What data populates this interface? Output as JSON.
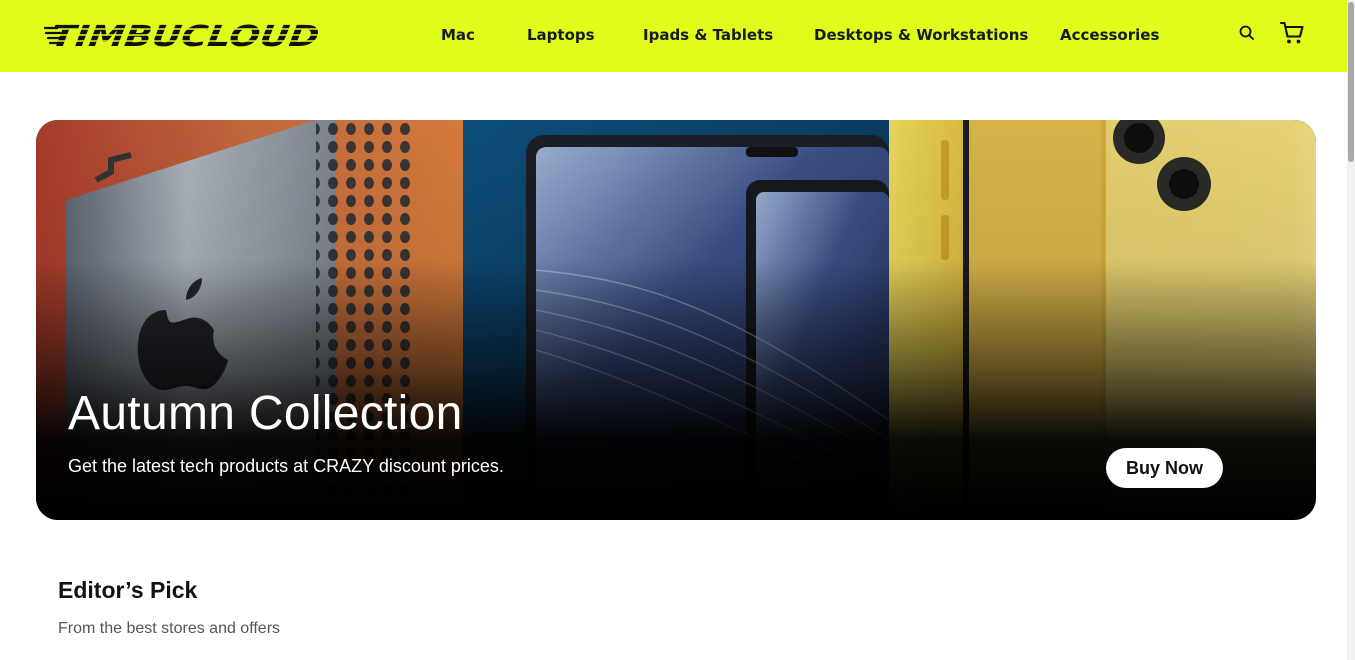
{
  "brand": {
    "logo_text": "TIMBUCLOUD",
    "accent": "#dffc1a"
  },
  "nav": {
    "items": [
      {
        "label": "Mac"
      },
      {
        "label": "Laptops"
      },
      {
        "label": "Ipads & Tablets"
      },
      {
        "label": "Desktops & Workstations"
      },
      {
        "label": "Accessories"
      }
    ],
    "search_icon": "search-icon",
    "cart_icon": "cart-icon"
  },
  "hero": {
    "title": "Autumn Collection",
    "subtitle": "Get the latest tech products at CRAZY discount prices.",
    "cta_label": "Buy Now"
  },
  "editors_pick": {
    "title": "Editor’s Pick",
    "subtitle": "From the best stores and offers"
  }
}
